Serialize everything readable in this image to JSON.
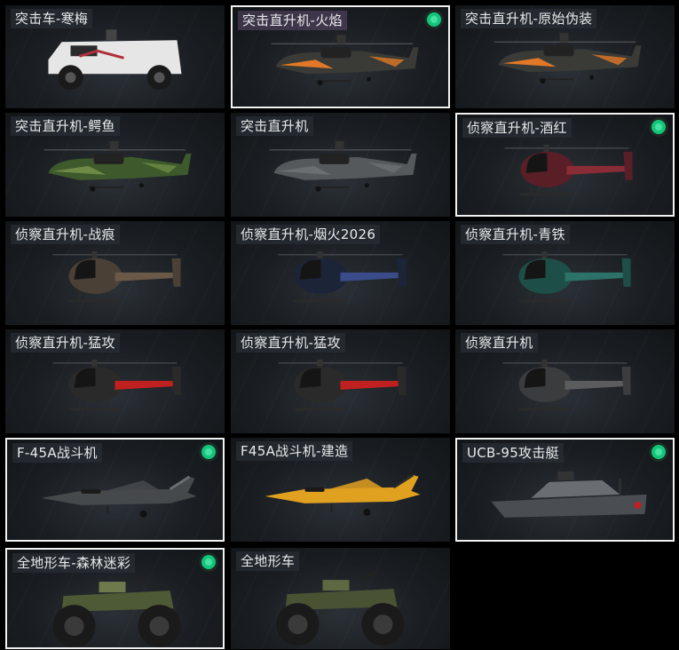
{
  "items": [
    {
      "label": "突击车-寒梅",
      "kind": "truck",
      "selected": false,
      "equipped": false,
      "highlight": false,
      "colors": {
        "body": "#e6e6e6",
        "accent": "#b0303a"
      }
    },
    {
      "label": "突击直升机-火焰",
      "kind": "attack-heli",
      "selected": true,
      "equipped": true,
      "highlight": true,
      "colors": {
        "body": "#3a3a36",
        "accent": "#e07828"
      }
    },
    {
      "label": "突击直升机-原始伪装",
      "kind": "attack-heli",
      "selected": false,
      "equipped": false,
      "highlight": false,
      "colors": {
        "body": "#3a3a36",
        "accent": "#e07828"
      }
    },
    {
      "label": "突击直升机-鳄鱼",
      "kind": "attack-heli",
      "selected": false,
      "equipped": false,
      "highlight": false,
      "colors": {
        "body": "#3e5a2c",
        "accent": "#6e8a46"
      }
    },
    {
      "label": "突击直升机",
      "kind": "attack-heli",
      "selected": false,
      "equipped": false,
      "highlight": false,
      "colors": {
        "body": "#55595c",
        "accent": "#6b6f72"
      }
    },
    {
      "label": "侦察直升机-酒红",
      "kind": "scout-heli",
      "selected": true,
      "equipped": true,
      "highlight": false,
      "colors": {
        "body": "#5a1e26",
        "accent": "#8a2c36"
      }
    },
    {
      "label": "侦察直升机-战痕",
      "kind": "scout-heli",
      "selected": false,
      "equipped": false,
      "highlight": false,
      "colors": {
        "body": "#4a4036",
        "accent": "#6a5848"
      }
    },
    {
      "label": "侦察直升机-烟火2026",
      "kind": "scout-heli",
      "selected": false,
      "equipped": false,
      "highlight": false,
      "colors": {
        "body": "#1c2438",
        "accent": "#3a4c8a"
      }
    },
    {
      "label": "侦察直升机-青铁",
      "kind": "scout-heli",
      "selected": false,
      "equipped": false,
      "highlight": false,
      "colors": {
        "body": "#1e4e48",
        "accent": "#2c7268"
      }
    },
    {
      "label": "侦察直升机-猛攻",
      "kind": "scout-heli",
      "selected": false,
      "equipped": false,
      "highlight": false,
      "colors": {
        "body": "#2a2a2a",
        "accent": "#c02020"
      }
    },
    {
      "label": "侦察直升机-猛攻",
      "kind": "scout-heli",
      "selected": false,
      "equipped": false,
      "highlight": false,
      "colors": {
        "body": "#2a2a2a",
        "accent": "#c02020"
      }
    },
    {
      "label": "侦察直升机",
      "kind": "scout-heli",
      "selected": false,
      "equipped": false,
      "highlight": false,
      "colors": {
        "body": "#3a3c3e",
        "accent": "#5a5c5e"
      }
    },
    {
      "label": "F-45A战斗机",
      "kind": "jet",
      "selected": true,
      "equipped": true,
      "highlight": false,
      "colors": {
        "body": "#46494c",
        "accent": "#6a6d70"
      }
    },
    {
      "label": "F45A战斗机-建造",
      "kind": "jet",
      "selected": false,
      "equipped": false,
      "highlight": false,
      "colors": {
        "body": "#e0a020",
        "accent": "#2a2a2a"
      }
    },
    {
      "label": "UCB-95攻击艇",
      "kind": "boat",
      "selected": true,
      "equipped": true,
      "highlight": false,
      "colors": {
        "body": "#4a4e52",
        "accent": "#6a6e72"
      }
    },
    {
      "label": "全地形车-森林迷彩",
      "kind": "atv",
      "selected": true,
      "equipped": true,
      "highlight": false,
      "colors": {
        "body": "#4e5a36",
        "accent": "#6e7a4c"
      }
    },
    {
      "label": "全地形车",
      "kind": "atv",
      "selected": false,
      "equipped": false,
      "highlight": false,
      "colors": {
        "body": "#4a5234",
        "accent": "#5e6842"
      }
    }
  ]
}
